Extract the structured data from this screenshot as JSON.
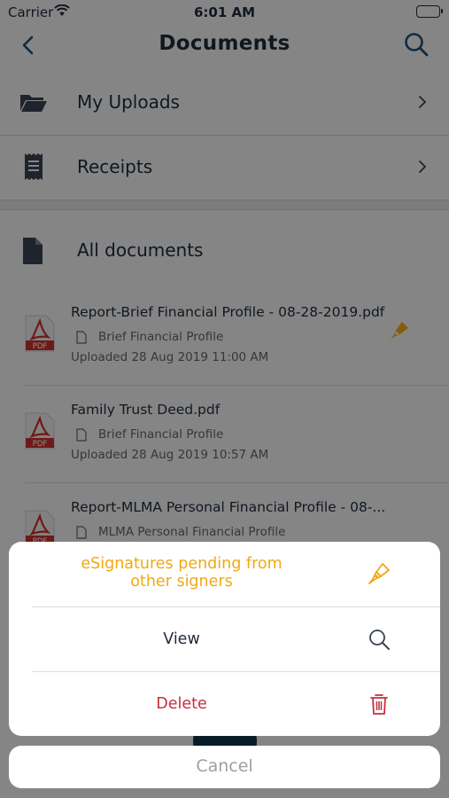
{
  "status_bar": {
    "carrier": "Carrier",
    "time": "6:01 AM"
  },
  "nav": {
    "title": "Documents",
    "back_icon": "back-chevron-icon",
    "search_icon": "search-icon"
  },
  "menu": [
    {
      "label": "My Uploads",
      "icon": "folder-open-icon"
    },
    {
      "label": "Receipts",
      "icon": "receipt-icon"
    }
  ],
  "all_documents": {
    "label": "All documents",
    "icon": "document-icon"
  },
  "documents": [
    {
      "name": "Report-Brief Financial Profile - 08-28-2019.pdf",
      "category": "Brief Financial Profile",
      "uploaded": "Uploaded 28 Aug 2019 11:00 AM",
      "esign": true
    },
    {
      "name": "Family Trust Deed.pdf",
      "category": "Brief Financial Profile",
      "uploaded": "Uploaded 28 Aug 2019 10:57 AM",
      "esign": false
    },
    {
      "name": "Report-MLMA Personal Financial Profile - 08-...",
      "category": "MLMA Personal Financial Profile",
      "uploaded": "",
      "esign": false
    }
  ],
  "action_sheet": {
    "pending_line1": "eSignatures pending from",
    "pending_line2": "other signers",
    "view_label": "View",
    "delete_label": "Delete",
    "cancel_label": "Cancel"
  },
  "colors": {
    "accent_orange": "#f0a815",
    "delete_red": "#c62f3c",
    "navy": "#0e3449",
    "pdf_red": "#c9302c"
  }
}
